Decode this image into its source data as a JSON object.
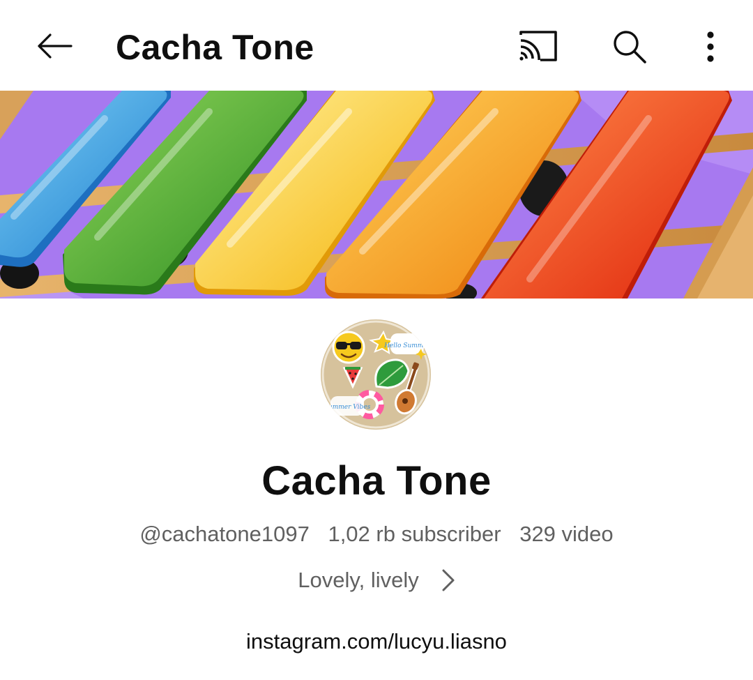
{
  "header": {
    "title": "Cacha Tone",
    "back_icon": "arrow-left-icon",
    "cast_icon": "cast-icon",
    "search_icon": "search-icon",
    "more_icon": "more-vertical-icon"
  },
  "banner": {
    "bar_colors": [
      "#3fa9e6",
      "#4db33a",
      "#f7cc2a",
      "#f7a21e",
      "#f0521e"
    ],
    "background_color": "#a779f0"
  },
  "channel": {
    "avatar_icon": "summer-stickers-avatar",
    "avatar_texts": [
      "Hello Summer",
      "Summer Vibes"
    ],
    "name": "Cacha Tone",
    "handle": "@cachatone1097",
    "subscribers": "1,02 rb subscriber",
    "videos": "329 video",
    "description": "Lovely, lively",
    "link": "instagram.com/lucyu.liasno"
  }
}
